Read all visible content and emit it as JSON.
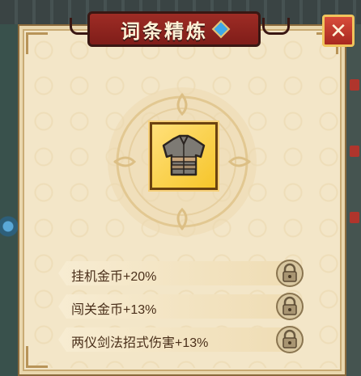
{
  "title": "词条精炼",
  "close_icon": "close-x-icon",
  "item_icon": "armor-icon",
  "attributes": [
    {
      "label": "挂机金币+20%",
      "lock_icon": "lock-icon"
    },
    {
      "label": "闯关金币+13%",
      "lock_icon": "lock-icon"
    },
    {
      "label": "两仪剑法招式伤害+13%",
      "lock_icon": "lock-icon"
    }
  ],
  "colors": {
    "panel_bg": "#f3e6c8",
    "banner_red": "#9e2c25",
    "slot_gold": "#f6c52a",
    "text_brown": "#4a2f1a"
  }
}
